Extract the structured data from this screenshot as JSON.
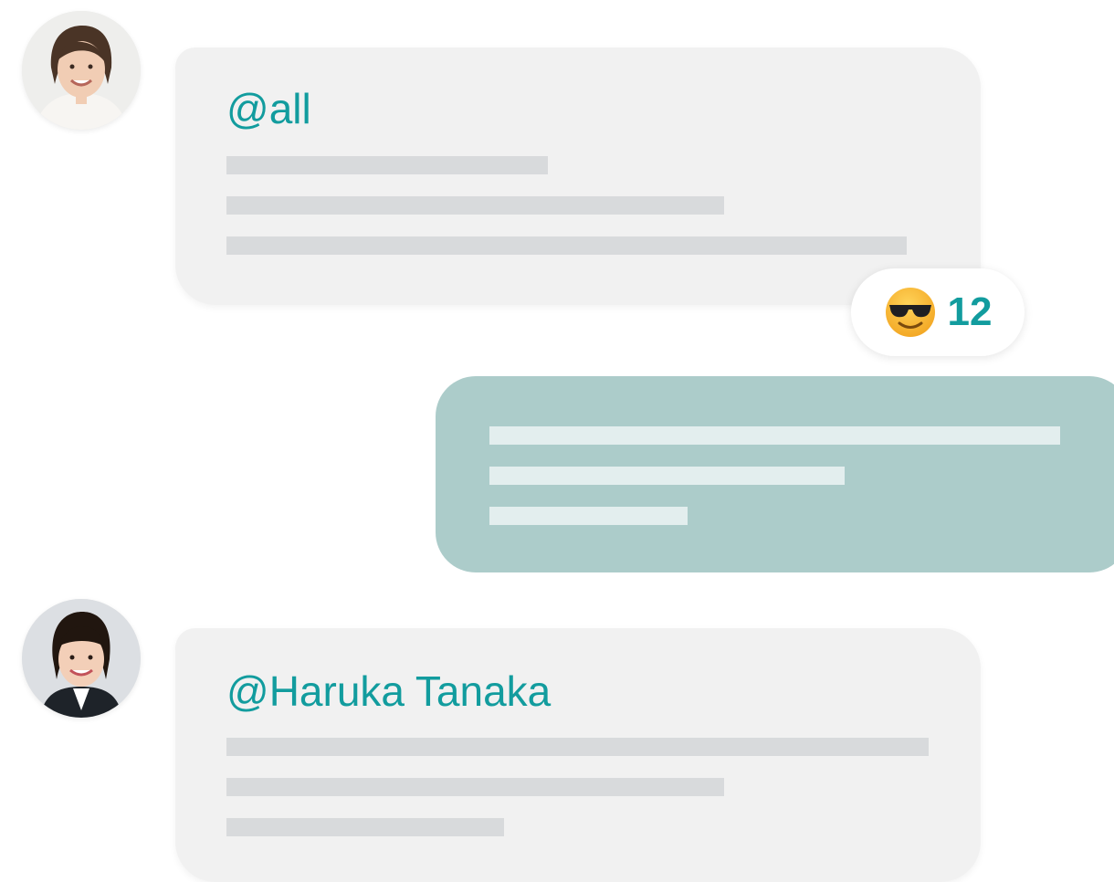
{
  "messages": [
    {
      "sender": "left",
      "mention": "@all",
      "reaction": {
        "icon": "smiling-face-with-sunglasses-icon",
        "count": "12"
      }
    },
    {
      "sender": "right"
    },
    {
      "sender": "left",
      "mention": "@Haruka Tanaka"
    }
  ],
  "colors": {
    "accent": "#129c9e",
    "incoming_bubble": "#f1f1f1",
    "outgoing_bubble": "#acccca",
    "placeholder_line": "#d8dadc"
  }
}
